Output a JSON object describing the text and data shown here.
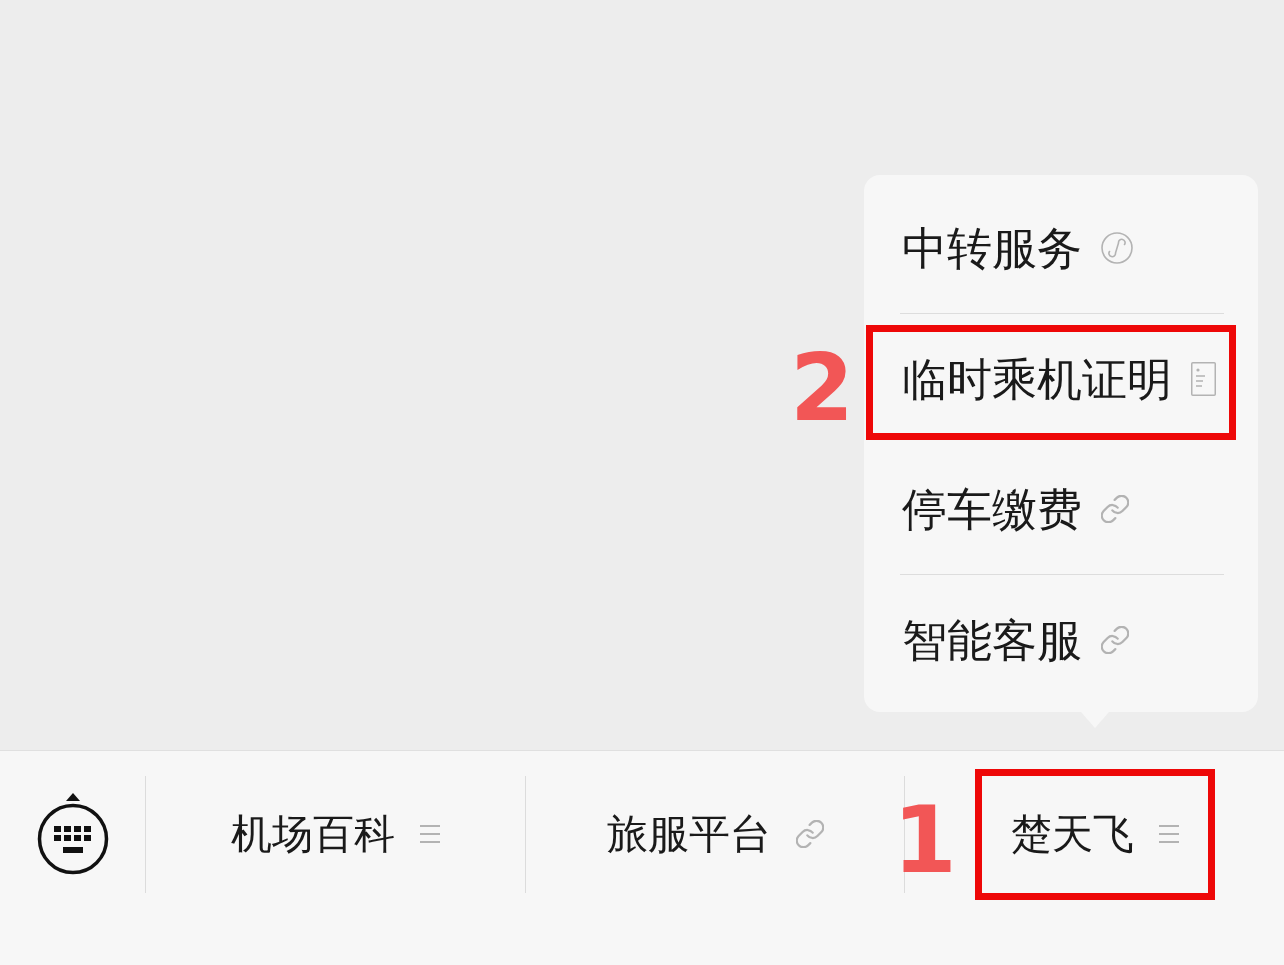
{
  "popup_menu": {
    "groups": [
      {
        "items": [
          {
            "label": "中转服务",
            "kind": "mini_program"
          }
        ]
      },
      {
        "items": [
          {
            "label": "临时乘机证明",
            "kind": "article",
            "callout": "2"
          },
          {
            "label": "停车缴费",
            "kind": "link"
          }
        ]
      },
      {
        "items": [
          {
            "label": "智能客服",
            "kind": "link"
          }
        ]
      }
    ]
  },
  "bottom_bar": {
    "items": [
      {
        "label": "机场百科",
        "kind": "submenu"
      },
      {
        "label": "旅服平台",
        "kind": "link"
      },
      {
        "label": "楚天飞",
        "kind": "submenu",
        "callout": "1"
      }
    ]
  }
}
